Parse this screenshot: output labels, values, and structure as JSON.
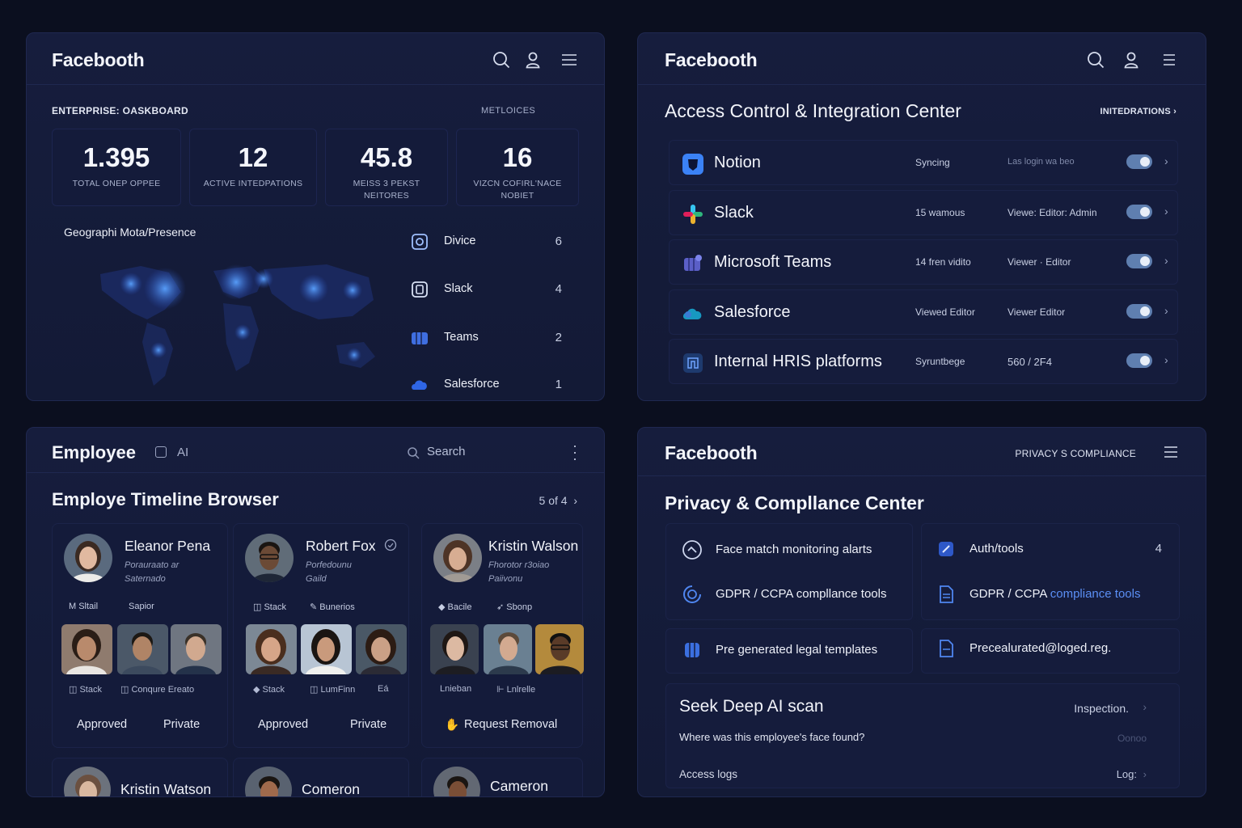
{
  "dashboard": {
    "brand": "Facebooth",
    "enterprise_label": "ENTERPRISE:  OASKBOARD",
    "metrics_label": "METLOICES",
    "stats": [
      {
        "value": "1.395",
        "label": "TOTAL ONEP OPPEE"
      },
      {
        "value": "12",
        "label": "ACTIVE INTEDPATIONS"
      },
      {
        "value": "45.8",
        "label": "MEISS 3 PEKST NEITORES"
      },
      {
        "value": "16",
        "label": "VIZCN COFIRL'NACE NOBIET"
      }
    ],
    "map_title": "Geographi Mota/Presence",
    "sources": [
      {
        "name": "Divice",
        "count": "6",
        "icon": "device-icon"
      },
      {
        "name": "Slack",
        "count": "4",
        "icon": "slack-icon"
      },
      {
        "name": "Teams",
        "count": "2",
        "icon": "teams-icon"
      },
      {
        "name": "Salesforce",
        "count": "1",
        "icon": "salesforce-icon"
      }
    ]
  },
  "access": {
    "brand": "Facebooth",
    "title": "Access Control & Integration Center",
    "integrations_link": "INITEDRATIONS",
    "rows": [
      {
        "name": "Notion",
        "status": "Syncing",
        "detail": "Las login wa beo",
        "dim": true,
        "icon": "notion-icon"
      },
      {
        "name": "Slack",
        "status": "15 wamous",
        "detail": "Viewe: Editor: Admin",
        "dim": false,
        "icon": "slack-icon"
      },
      {
        "name": "Microsoft Teams",
        "status": "14 fren vidito",
        "detail": "Viewer · Editor",
        "dim": false,
        "icon": "teams-icon"
      },
      {
        "name": "Salesforce",
        "status": "Viewed Editor",
        "detail": "Viewer Editor",
        "dim": false,
        "icon": "salesforce-icon"
      },
      {
        "name": "Internal HRIS platforms",
        "status": "Syruntbege",
        "detail": "560 / 2F4",
        "dim": false,
        "icon": "hris-icon"
      }
    ]
  },
  "employee": {
    "title": "Employee",
    "ai_label": "AI",
    "search_placeholder": "Search",
    "subtitle": "Employe Timeline Browser",
    "count": "5 of 4",
    "cards": [
      {
        "name": "Eleanor Pena",
        "role1": "Porauraato ar",
        "role2": "Saternado",
        "tags": [
          "M  Sltail",
          "Sapior"
        ],
        "srcs": [
          "◫ Stack",
          "◫ Conqure Ereato"
        ],
        "acts": [
          "Approved",
          "Private"
        ]
      },
      {
        "name": "Robert Fox",
        "role1": "Porfedounu",
        "role2": "Gaild",
        "tags": [
          "◫ Stack",
          "✎ Bunerios"
        ],
        "srcs": [
          "◆ Stack",
          "◫ LumFinn",
          "Eá"
        ],
        "acts": [
          "Approved",
          "Private"
        ]
      },
      {
        "name": "Kristin Walson",
        "role1": "Fhorotor r3oiao",
        "role2": "Paiivonu",
        "tags": [
          "◆ Bacile",
          "➶ Sbonp"
        ],
        "srcs": [
          "Lnieban",
          "⊩ Lnlrelle"
        ],
        "acts": [
          "Request Removal"
        ]
      }
    ],
    "more": [
      {
        "name": "Kristin Watson"
      },
      {
        "name": "Comeron Willian."
      },
      {
        "name": "Cameron Will.."
      }
    ]
  },
  "privacy": {
    "brand": "Facebooth",
    "nav_label": "PRIVACY S COMPLIANCE",
    "title": "Privacy & Compllance Center",
    "items": [
      {
        "text": "Face match monitoring alarts",
        "icon": "face-scan-icon"
      },
      {
        "text": "GDPR / CCPA compllance tools",
        "icon": "refresh-shield-icon"
      },
      {
        "text": "Pre generated legal templates",
        "icon": "template-icon"
      }
    ],
    "right_items": [
      {
        "text": "Auth/tools",
        "count": "4",
        "icon": "auth-icon"
      },
      {
        "text_a": "GDPR / CCPA ",
        "text_b": "compliance tools",
        "icon": "document-icon"
      },
      {
        "text": "Precealurated@loged.reg.",
        "icon": "file-icon"
      }
    ],
    "scan": {
      "title": "Seek Deep AI scan",
      "inspection": "Inspection.",
      "question": "Where was this employee's face found?",
      "question_hint": "Oonoo",
      "access_logs": "Access logs",
      "logs_link": "Log:"
    }
  }
}
